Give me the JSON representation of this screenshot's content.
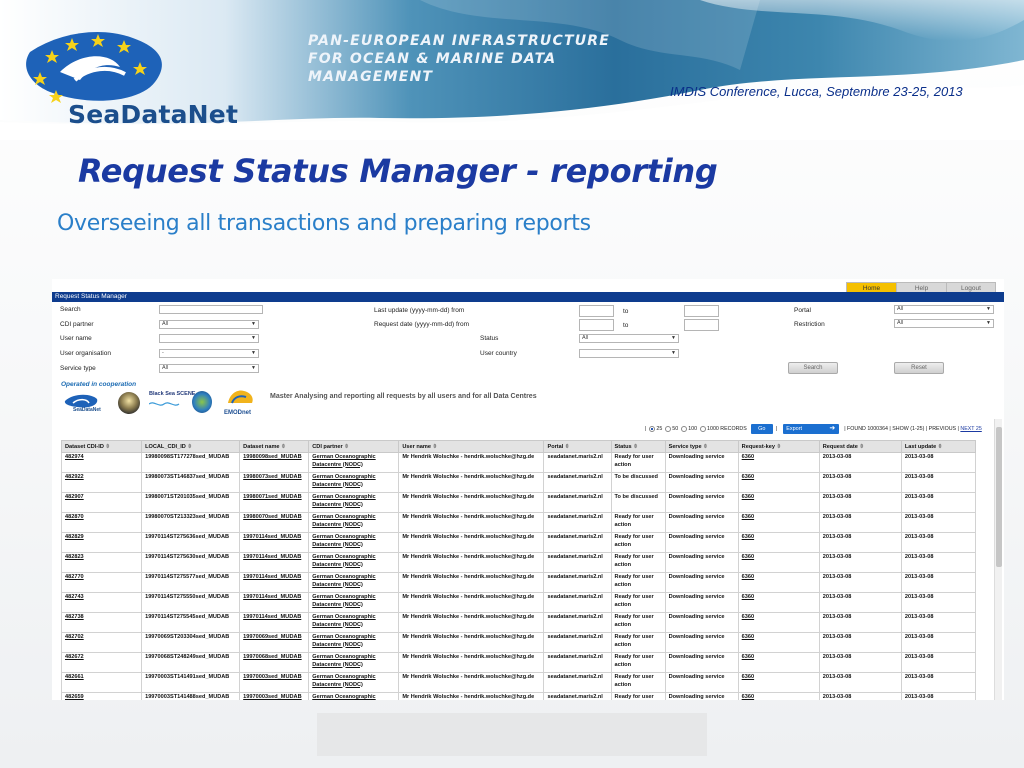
{
  "slide": {
    "logo_text": "SeaDataNet",
    "tagline": [
      "PAN-EUROPEAN INFRASTRUCTURE",
      "FOR OCEAN & MARINE DATA",
      "MANAGEMENT"
    ],
    "conference": "IMDIS Conference, Lucca, Septembre 23-25, 2013",
    "title": "Request Status Manager - reporting",
    "subtitle": "Overseeing all transactions and preparing reports"
  },
  "app": {
    "nav": [
      "Home",
      "Help",
      "Logout"
    ],
    "app_title": "Request Status Manager",
    "form": {
      "search_label": "Search",
      "cdi_partner_label": "CDI partner",
      "cdi_partner_value": "All",
      "user_name_label": "User name",
      "user_org_label": "User organisation",
      "user_org_value": "-",
      "service_type_label": "Service type",
      "service_type_value": "All",
      "last_update_label": "Last update (yyyy-mm-dd) from",
      "request_date_label": "Request date (yyyy-mm-dd) from",
      "to_label": "to",
      "status_label": "Status",
      "status_value": "All",
      "user_country_label": "User country",
      "portal_label": "Portal",
      "portal_value": "All",
      "restriction_label": "Restriction",
      "restriction_value": "All",
      "search_button": "Search",
      "reset_button": "Reset"
    },
    "cooperation_label": "Operated in cooperation",
    "partner_logos": [
      "SeaDataNet",
      "Black Sea SCENE",
      "EMODnet"
    ],
    "master_text": "Master Analysing and reporting all requests by all users and for all Data Centres",
    "pager": {
      "options": [
        "25",
        "50",
        "100",
        "1000 RECORDS"
      ],
      "selected": "25",
      "go": "Go",
      "export": "Export",
      "found_text": "| FOUND 1000364 | SHOW (1-25) | PREVIOUS | ",
      "next_text": "NEXT 25"
    },
    "columns": [
      "Dataset CDI-ID",
      "LOCAL_CDI_ID",
      "Dataset name",
      "CDI partner",
      "User name",
      "Portal",
      "Status",
      "Service type",
      "Request-key",
      "Request date",
      "Last update"
    ],
    "rows": [
      [
        "482974",
        "19980098ST177278sed_MUDAB",
        "19980098sed_MUDAB",
        "German Oceanographic Datacentre (NODC)",
        "Mr Hendrik Wolschke - hendrik.wolschke@hzg.de",
        "seadatanet.maris2.nl",
        "Ready for user action",
        "Downloading service",
        "6360",
        "2013-03-08",
        "2013-03-08"
      ],
      [
        "482922",
        "19980073ST146837sed_MUDAB",
        "19980073sed_MUDAB",
        "German Oceanographic Datacentre (NODC)",
        "Mr Hendrik Wolschke - hendrik.wolschke@hzg.de",
        "seadatanet.maris2.nl",
        "To be discussed",
        "Downloading service",
        "6360",
        "2013-03-08",
        "2013-03-08"
      ],
      [
        "482907",
        "19980071ST201035sed_MUDAB",
        "19980071sed_MUDAB",
        "German Oceanographic Datacentre (NODC)",
        "Mr Hendrik Wolschke - hendrik.wolschke@hzg.de",
        "seadatanet.maris2.nl",
        "To be discussed",
        "Downloading service",
        "6360",
        "2013-03-08",
        "2013-03-08"
      ],
      [
        "482870",
        "19980070ST213323sed_MUDAB",
        "19980070sed_MUDAB",
        "German Oceanographic Datacentre (NODC)",
        "Mr Hendrik Wolschke - hendrik.wolschke@hzg.de",
        "seadatanet.maris2.nl",
        "Ready for user action",
        "Downloading service",
        "6360",
        "2013-03-08",
        "2013-03-08"
      ],
      [
        "482829",
        "19970114ST275636sed_MUDAB",
        "19970114sed_MUDAB",
        "German Oceanographic Datacentre (NODC)",
        "Mr Hendrik Wolschke - hendrik.wolschke@hzg.de",
        "seadatanet.maris2.nl",
        "Ready for user action",
        "Downloading service",
        "6360",
        "2013-03-08",
        "2013-03-08"
      ],
      [
        "482823",
        "19970114ST275630sed_MUDAB",
        "19970114sed_MUDAB",
        "German Oceanographic Datacentre (NODC)",
        "Mr Hendrik Wolschke - hendrik.wolschke@hzg.de",
        "seadatanet.maris2.nl",
        "Ready for user action",
        "Downloading service",
        "6360",
        "2013-03-08",
        "2013-03-08"
      ],
      [
        "482770",
        "19970114ST275577sed_MUDAB",
        "19970114sed_MUDAB",
        "German Oceanographic Datacentre (NODC)",
        "Mr Hendrik Wolschke - hendrik.wolschke@hzg.de",
        "seadatanet.maris2.nl",
        "Ready for user action",
        "Downloading service",
        "6360",
        "2013-03-08",
        "2013-03-08"
      ],
      [
        "482743",
        "19970114ST275550sed_MUDAB",
        "19970114sed_MUDAB",
        "German Oceanographic Datacentre (NODC)",
        "Mr Hendrik Wolschke - hendrik.wolschke@hzg.de",
        "seadatanet.maris2.nl",
        "Ready for user action",
        "Downloading service",
        "6360",
        "2013-03-08",
        "2013-03-08"
      ],
      [
        "482738",
        "19970114ST275545sed_MUDAB",
        "19970114sed_MUDAB",
        "German Oceanographic Datacentre (NODC)",
        "Mr Hendrik Wolschke - hendrik.wolschke@hzg.de",
        "seadatanet.maris2.nl",
        "Ready for user action",
        "Downloading service",
        "6360",
        "2013-03-08",
        "2013-03-08"
      ],
      [
        "482702",
        "19970069ST203304sed_MUDAB",
        "19970069sed_MUDAB",
        "German Oceanographic Datacentre (NODC)",
        "Mr Hendrik Wolschke - hendrik.wolschke@hzg.de",
        "seadatanet.maris2.nl",
        "Ready for user action",
        "Downloading service",
        "6360",
        "2013-03-08",
        "2013-03-08"
      ],
      [
        "482672",
        "19970068ST248249sed_MUDAB",
        "19970068sed_MUDAB",
        "German Oceanographic Datacentre (NODC)",
        "Mr Hendrik Wolschke - hendrik.wolschke@hzg.de",
        "seadatanet.maris2.nl",
        "Ready for user action",
        "Downloading service",
        "6360",
        "2013-03-08",
        "2013-03-08"
      ],
      [
        "482661",
        "19970003ST141491sed_MUDAB",
        "19970003sed_MUDAB",
        "German Oceanographic Datacentre (NODC)",
        "Mr Hendrik Wolschke - hendrik.wolschke@hzg.de",
        "seadatanet.maris2.nl",
        "Ready for user action",
        "Downloading service",
        "6360",
        "2013-03-08",
        "2013-03-08"
      ],
      [
        "482659",
        "19970003ST141488sed_MUDAB",
        "19970003sed_MUDAB",
        "German Oceanographic Datacentre (NODC)",
        "Mr Hendrik Wolschke - hendrik.wolschke@hzg.de",
        "seadatanet.maris2.nl",
        "Ready for user action",
        "Downloading service",
        "6360",
        "2013-03-08",
        "2013-03-08"
      ]
    ]
  }
}
